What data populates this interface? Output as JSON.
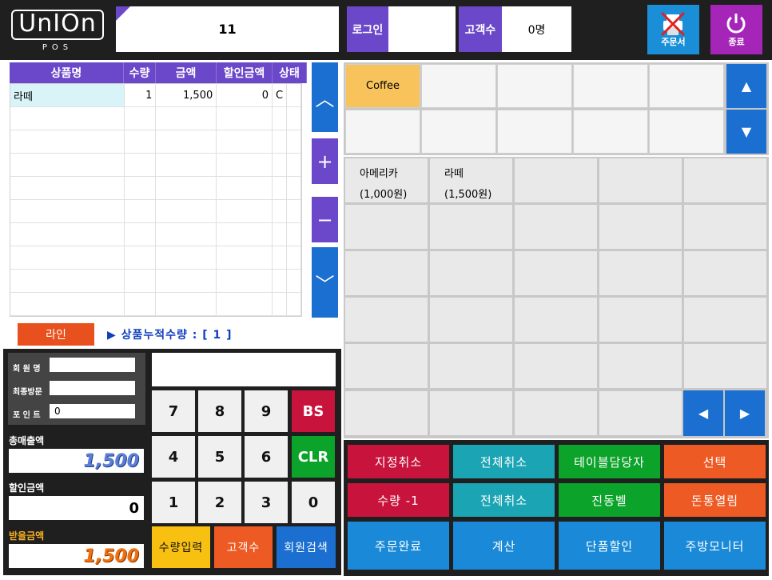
{
  "header": {
    "logo_main": "UnIOn",
    "logo_sub": "POS",
    "table_number": "11",
    "login_label": "로그인",
    "login_value": "",
    "customer_label": "고객수",
    "customer_value": "0명",
    "order_button_label": "주문서",
    "exit_button_label": "종료"
  },
  "order_table": {
    "columns": [
      "상품명",
      "수량",
      "금액",
      "할인금액",
      "상태"
    ],
    "rows": [
      {
        "name": "라떼",
        "qty": "1",
        "amount": "1,500",
        "discount": "0",
        "status": "C"
      }
    ]
  },
  "side_controls": {
    "up": "︿",
    "plus": "+",
    "minus": "−",
    "down": "﹀"
  },
  "line_button": "라인",
  "accumulated_text": "▶ 상품누적수량 : [ 1 ]",
  "member": {
    "name_label": "회 원 명",
    "name_value": "",
    "last_visit_label": "최종방문",
    "last_visit_value": "",
    "points_label": "포 인 트",
    "points_value": "0"
  },
  "totals": {
    "total_sales_label": "총매출액",
    "total_sales_value": "1,500",
    "discount_label": "할인금액",
    "discount_value": "0",
    "receive_label": "받을금액",
    "receive_value": "1,500"
  },
  "keypad": {
    "display_value": "",
    "keys": [
      "7",
      "8",
      "9",
      "BS",
      "4",
      "5",
      "6",
      "CLR",
      "1",
      "2",
      "3",
      "0"
    ],
    "qty_input": "수량입력",
    "customer_count": "고객수",
    "member_search": "회원검색"
  },
  "categories": {
    "items": [
      "Coffee",
      "",
      "",
      "",
      "",
      "",
      "",
      "",
      "",
      ""
    ],
    "up_arrow": "▲",
    "down_arrow": "▼"
  },
  "products": {
    "items": [
      {
        "name": "아메리카",
        "price": "(1,000원)"
      },
      {
        "name": "라떼",
        "price": "(1,500원)"
      }
    ],
    "left_arrow": "◀",
    "right_arrow": "▶"
  },
  "functions": {
    "row1": [
      "지정취소",
      "전체취소",
      "테이블담당자",
      "선택"
    ],
    "row2": [
      "수량 -1",
      "전체취소",
      "진동벨",
      "돈통열림"
    ],
    "row3": [
      "주문완료",
      "계산",
      "단품할인",
      "주방모니터"
    ]
  },
  "colors": {
    "purple": "#6b47c9",
    "blue": "#1a6fd0",
    "orange": "#ee5a24",
    "red": "#c8143c",
    "teal": "#1aa4b4",
    "green": "#0ca32a",
    "yellow": "#f8c35a"
  }
}
